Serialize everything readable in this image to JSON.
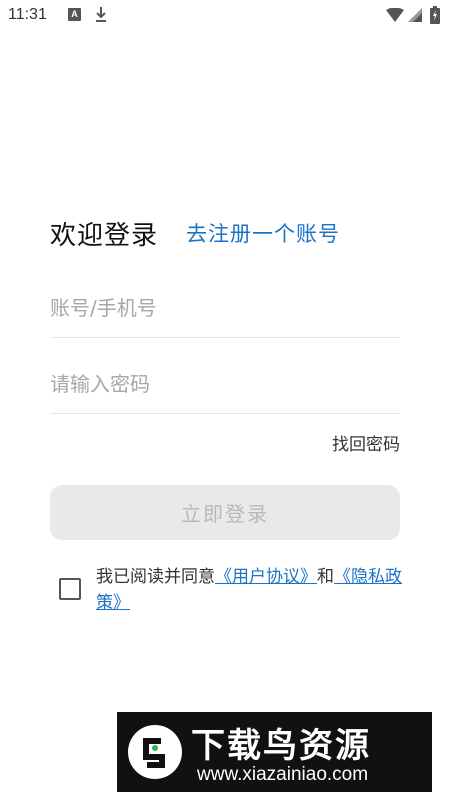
{
  "status_bar": {
    "time": "11:31",
    "icons": [
      "a-notification-icon",
      "download-icon",
      "wifi-icon",
      "cell-signal-icon",
      "battery-icon"
    ]
  },
  "login": {
    "title": "欢迎登录",
    "register_link": "去注册一个账号",
    "account_placeholder": "账号/手机号",
    "password_placeholder": "请输入密码",
    "forgot_password": "找回密码",
    "login_button": "立即登录"
  },
  "agreement": {
    "prefix": "我已阅读并同意",
    "user_agreement": "《用户协议》",
    "and": "和",
    "privacy_policy": "《隐私政策》",
    "checked": false
  },
  "watermark": {
    "title": "下载鸟资源",
    "url": "www.xiazainiao.com"
  },
  "colors": {
    "link": "#1a73c7",
    "button_bg": "#e9e9e9",
    "button_text": "#b9b9b9",
    "placeholder": "#a7a7a7"
  }
}
